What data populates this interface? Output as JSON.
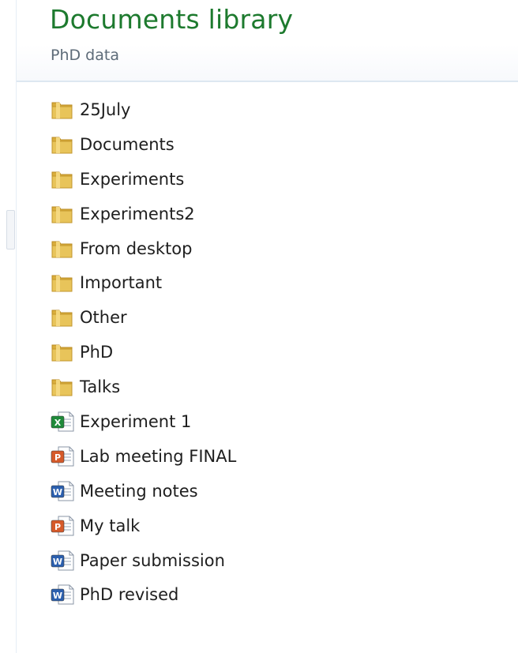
{
  "library": {
    "title": "Documents library",
    "subtitle": "PhD data"
  },
  "colors": {
    "title": "#1d7a2e",
    "subtitle": "#5d6b78",
    "folder": "#e8c45a",
    "excel": "#1f8a3a",
    "powerpoint": "#d65a2a",
    "word": "#2b5fae"
  },
  "items": [
    {
      "label": "25July",
      "icon": "folder-icon"
    },
    {
      "label": "Documents",
      "icon": "folder-icon"
    },
    {
      "label": "Experiments",
      "icon": "folder-icon"
    },
    {
      "label": "Experiments2",
      "icon": "folder-icon"
    },
    {
      "label": "From desktop",
      "icon": "folder-icon"
    },
    {
      "label": "Important",
      "icon": "folder-icon"
    },
    {
      "label": "Other",
      "icon": "folder-icon"
    },
    {
      "label": "PhD",
      "icon": "folder-icon"
    },
    {
      "label": "Talks",
      "icon": "folder-icon"
    },
    {
      "label": "Experiment 1",
      "icon": "excel-file-icon"
    },
    {
      "label": "Lab meeting FINAL",
      "icon": "powerpoint-file-icon"
    },
    {
      "label": "Meeting notes",
      "icon": "word-file-icon"
    },
    {
      "label": "My talk",
      "icon": "powerpoint-file-icon"
    },
    {
      "label": "Paper submission",
      "icon": "word-file-icon"
    },
    {
      "label": "PhD revised",
      "icon": "word-file-icon"
    }
  ]
}
